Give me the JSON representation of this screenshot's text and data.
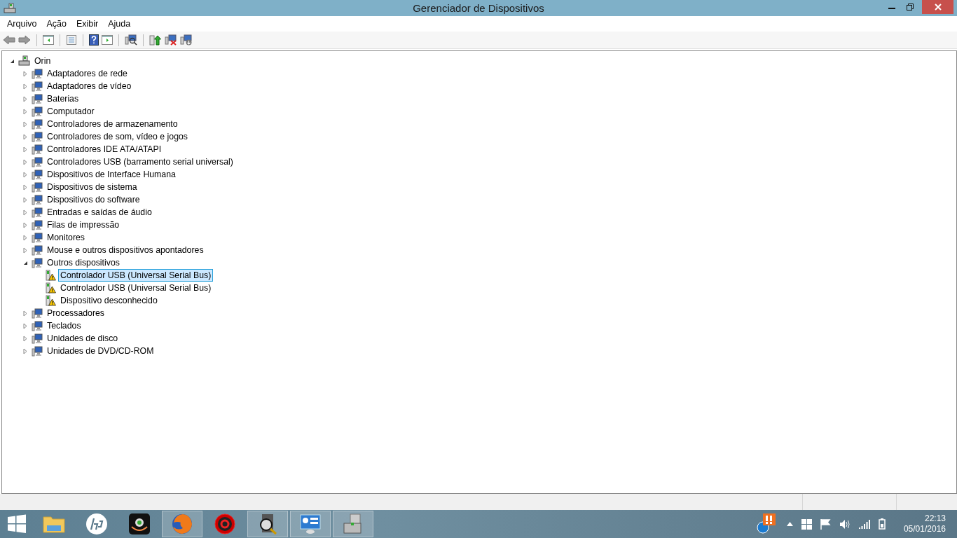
{
  "window": {
    "title": "Gerenciador de Dispositivos"
  },
  "menu": [
    "Arquivo",
    "Ação",
    "Exibir",
    "Ajuda"
  ],
  "tree": {
    "label": "Orin",
    "expanded": true,
    "selected": false,
    "children": [
      {
        "label": "Adaptadores de rede",
        "expanded": false,
        "selected": false
      },
      {
        "label": "Adaptadores de vídeo",
        "expanded": false,
        "selected": false
      },
      {
        "label": "Baterias",
        "expanded": false,
        "selected": false
      },
      {
        "label": "Computador",
        "expanded": false,
        "selected": false
      },
      {
        "label": "Controladores de armazenamento",
        "expanded": false,
        "selected": false
      },
      {
        "label": "Controladores de som, vídeo e jogos",
        "expanded": false,
        "selected": false
      },
      {
        "label": "Controladores IDE ATA/ATAPI",
        "expanded": false,
        "selected": false
      },
      {
        "label": "Controladores USB (barramento serial universal)",
        "expanded": false,
        "selected": false
      },
      {
        "label": "Dispositivos de Interface Humana",
        "expanded": false,
        "selected": false
      },
      {
        "label": "Dispositivos de sistema",
        "expanded": false,
        "selected": false
      },
      {
        "label": "Dispositivos do software",
        "expanded": false,
        "selected": false
      },
      {
        "label": "Entradas e saídas de áudio",
        "expanded": false,
        "selected": false
      },
      {
        "label": "Filas de impressão",
        "expanded": false,
        "selected": false
      },
      {
        "label": "Monitores",
        "expanded": false,
        "selected": false
      },
      {
        "label": "Mouse e outros dispositivos apontadores",
        "expanded": false,
        "selected": false
      },
      {
        "label": "Outros dispositivos",
        "expanded": true,
        "selected": false,
        "children": [
          {
            "label": "Controlador USB (Universal Serial Bus)",
            "selected": true,
            "warning": true
          },
          {
            "label": "Controlador USB (Universal Serial Bus)",
            "selected": false,
            "warning": true
          },
          {
            "label": "Dispositivo desconhecido",
            "selected": false,
            "warning": true
          }
        ]
      },
      {
        "label": "Processadores",
        "expanded": false,
        "selected": false
      },
      {
        "label": "Teclados",
        "expanded": false,
        "selected": false
      },
      {
        "label": "Unidades de disco",
        "expanded": false,
        "selected": false
      },
      {
        "label": "Unidades de DVD/CD-ROM",
        "expanded": false,
        "selected": false
      }
    ]
  },
  "taskbar": {
    "apps": [
      {
        "active": false
      },
      {
        "active": false
      },
      {
        "active": false
      },
      {
        "active": true
      },
      {
        "active": false
      },
      {
        "active": true
      },
      {
        "active": true
      },
      {
        "active": true
      }
    ],
    "clock": {
      "time": "22:13",
      "date": "05/01/2016"
    }
  }
}
